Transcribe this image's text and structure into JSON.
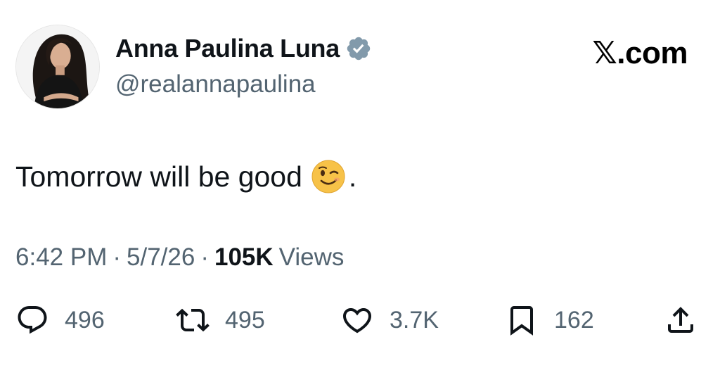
{
  "author": {
    "display_name": "Anna Paulina Luna",
    "handle": "@realannapaulina",
    "verified": true,
    "avatar_icon": "profile-photo"
  },
  "brand": {
    "label": "𝕏.com"
  },
  "tweet": {
    "text": "Tomorrow will be good",
    "emoji_icon": "winking-face-emoji",
    "trailing": "."
  },
  "meta": {
    "time": "6:42 PM",
    "separator": "·",
    "date": "5/7/26",
    "views_count": "105K",
    "views_label": "Views"
  },
  "actions": {
    "reply": {
      "count": "496",
      "icon": "reply-icon"
    },
    "retweet": {
      "count": "495",
      "icon": "retweet-icon"
    },
    "like": {
      "count": "3.7K",
      "icon": "heart-icon"
    },
    "bookmark": {
      "count": "162",
      "icon": "bookmark-icon"
    },
    "share": {
      "icon": "share-icon"
    }
  },
  "colors": {
    "text_primary": "#0f1419",
    "text_secondary": "#536471",
    "verified_badge": "#829aab"
  }
}
